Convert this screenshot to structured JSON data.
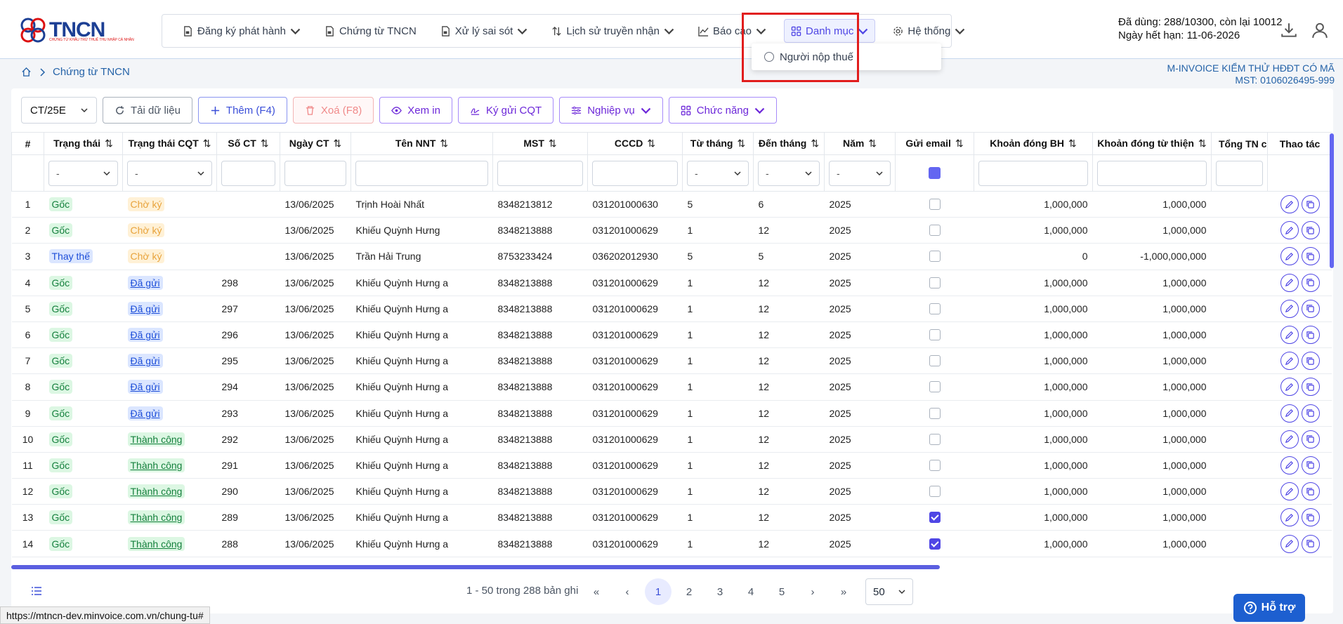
{
  "app": {
    "logo_text": "TNCN",
    "logo_subtitle": "CHỨNG TỪ KHẤU TRỪ THUẾ THU NHẬP CÁ NHÂN"
  },
  "nav": [
    {
      "label": "Đăng ký phát hành",
      "icon": "doc-icon",
      "has_menu": true
    },
    {
      "label": "Chứng từ TNCN",
      "icon": "doc-icon",
      "has_menu": false
    },
    {
      "label": "Xử lý sai sót",
      "icon": "doc-icon",
      "has_menu": true
    },
    {
      "label": "Lịch sử truyền nhận",
      "icon": "sort-icon",
      "has_menu": true
    },
    {
      "label": "Báo cáo",
      "icon": "chart-icon",
      "has_menu": true
    },
    {
      "label": "Danh mục",
      "icon": "grid-icon",
      "has_menu": true
    },
    {
      "label": "Hệ thống",
      "icon": "gear-icon",
      "has_menu": true
    }
  ],
  "dropdown": {
    "item": "Người nộp thuế"
  },
  "usage": {
    "line1": "Đã dùng: 288/10300, còn lại 10012",
    "line2": "Ngày hết hạn: 11-06-2026"
  },
  "breadcrumb": {
    "current": "Chứng từ TNCN"
  },
  "company": {
    "name": "M-INVOICE KIỂM THỬ HĐĐT CÓ MÃ",
    "tax_code": "MST: 0106026495-999"
  },
  "toolbar": {
    "template": "CT/25E",
    "reload": "Tải dữ liệu",
    "add": "Thêm (F4)",
    "delete": "Xoá (F8)",
    "print": "Xem in",
    "sign": "Ký gửi CQT",
    "business": "Nghiệp vụ",
    "functions": "Chức năng"
  },
  "table": {
    "headers": [
      "#",
      "Trạng thái",
      "Trạng thái CQT",
      "Số CT",
      "Ngày CT",
      "Tên NNT",
      "MST",
      "CCCD",
      "Từ tháng",
      "Đến tháng",
      "Năm",
      "Gửi email",
      "Khoản đóng BH",
      "Khoản đóng từ thiện",
      "Tổng TN c",
      "Thao tác"
    ],
    "filter_placeholder": "-",
    "rows": [
      {
        "no": "1",
        "status": "Gốc",
        "cqt": "Chờ ký",
        "so": "",
        "ngay": "13/06/2025",
        "ten": "Trịnh Hoài Nhất",
        "mst": "8348213812",
        "cccd": "031201000630",
        "tu": "5",
        "den": "6",
        "nam": "2025",
        "email": false,
        "bh": "1,000,000",
        "tt": "1,000,000"
      },
      {
        "no": "2",
        "status": "Gốc",
        "cqt": "Chờ ký",
        "so": "",
        "ngay": "13/06/2025",
        "ten": "Khiếu Quỳnh Hưng",
        "mst": "8348213888",
        "cccd": "031201000629",
        "tu": "1",
        "den": "12",
        "nam": "2025",
        "email": false,
        "bh": "1,000,000",
        "tt": "1,000,000"
      },
      {
        "no": "3",
        "status": "Thay thế",
        "cqt": "Chờ ký",
        "so": "",
        "ngay": "13/06/2025",
        "ten": "Trần Hải Trung",
        "mst": "8753233424",
        "cccd": "036202012930",
        "tu": "5",
        "den": "5",
        "nam": "2025",
        "email": false,
        "bh": "0",
        "tt": "-1,000,000,000"
      },
      {
        "no": "4",
        "status": "Gốc",
        "cqt": "Đã gửi",
        "so": "298",
        "ngay": "13/06/2025",
        "ten": "Khiếu Quỳnh Hưng a",
        "mst": "8348213888",
        "cccd": "031201000629",
        "tu": "1",
        "den": "12",
        "nam": "2025",
        "email": false,
        "bh": "1,000,000",
        "tt": "1,000,000"
      },
      {
        "no": "5",
        "status": "Gốc",
        "cqt": "Đã gửi",
        "so": "297",
        "ngay": "13/06/2025",
        "ten": "Khiếu Quỳnh Hưng a",
        "mst": "8348213888",
        "cccd": "031201000629",
        "tu": "1",
        "den": "12",
        "nam": "2025",
        "email": false,
        "bh": "1,000,000",
        "tt": "1,000,000"
      },
      {
        "no": "6",
        "status": "Gốc",
        "cqt": "Đã gửi",
        "so": "296",
        "ngay": "13/06/2025",
        "ten": "Khiếu Quỳnh Hưng a",
        "mst": "8348213888",
        "cccd": "031201000629",
        "tu": "1",
        "den": "12",
        "nam": "2025",
        "email": false,
        "bh": "1,000,000",
        "tt": "1,000,000"
      },
      {
        "no": "7",
        "status": "Gốc",
        "cqt": "Đã gửi",
        "so": "295",
        "ngay": "13/06/2025",
        "ten": "Khiếu Quỳnh Hưng a",
        "mst": "8348213888",
        "cccd": "031201000629",
        "tu": "1",
        "den": "12",
        "nam": "2025",
        "email": false,
        "bh": "1,000,000",
        "tt": "1,000,000"
      },
      {
        "no": "8",
        "status": "Gốc",
        "cqt": "Đã gửi",
        "so": "294",
        "ngay": "13/06/2025",
        "ten": "Khiếu Quỳnh Hưng a",
        "mst": "8348213888",
        "cccd": "031201000629",
        "tu": "1",
        "den": "12",
        "nam": "2025",
        "email": false,
        "bh": "1,000,000",
        "tt": "1,000,000"
      },
      {
        "no": "9",
        "status": "Gốc",
        "cqt": "Đã gửi",
        "so": "293",
        "ngay": "13/06/2025",
        "ten": "Khiếu Quỳnh Hưng a",
        "mst": "8348213888",
        "cccd": "031201000629",
        "tu": "1",
        "den": "12",
        "nam": "2025",
        "email": false,
        "bh": "1,000,000",
        "tt": "1,000,000"
      },
      {
        "no": "10",
        "status": "Gốc",
        "cqt": "Thành công",
        "so": "292",
        "ngay": "13/06/2025",
        "ten": "Khiếu Quỳnh Hưng a",
        "mst": "8348213888",
        "cccd": "031201000629",
        "tu": "1",
        "den": "12",
        "nam": "2025",
        "email": false,
        "bh": "1,000,000",
        "tt": "1,000,000"
      },
      {
        "no": "11",
        "status": "Gốc",
        "cqt": "Thành công",
        "so": "291",
        "ngay": "13/06/2025",
        "ten": "Khiếu Quỳnh Hưng a",
        "mst": "8348213888",
        "cccd": "031201000629",
        "tu": "1",
        "den": "12",
        "nam": "2025",
        "email": false,
        "bh": "1,000,000",
        "tt": "1,000,000"
      },
      {
        "no": "12",
        "status": "Gốc",
        "cqt": "Thành công",
        "so": "290",
        "ngay": "13/06/2025",
        "ten": "Khiếu Quỳnh Hưng a",
        "mst": "8348213888",
        "cccd": "031201000629",
        "tu": "1",
        "den": "12",
        "nam": "2025",
        "email": false,
        "bh": "1,000,000",
        "tt": "1,000,000"
      },
      {
        "no": "13",
        "status": "Gốc",
        "cqt": "Thành công",
        "so": "289",
        "ngay": "13/06/2025",
        "ten": "Khiếu Quỳnh Hưng a",
        "mst": "8348213888",
        "cccd": "031201000629",
        "tu": "1",
        "den": "12",
        "nam": "2025",
        "email": true,
        "bh": "1,000,000",
        "tt": "1,000,000"
      },
      {
        "no": "14",
        "status": "Gốc",
        "cqt": "Thành công",
        "so": "288",
        "ngay": "13/06/2025",
        "ten": "Khiếu Quỳnh Hưng a",
        "mst": "8348213888",
        "cccd": "031201000629",
        "tu": "1",
        "den": "12",
        "nam": "2025",
        "email": true,
        "bh": "1,000,000",
        "tt": "1,000,000"
      }
    ]
  },
  "pagination": {
    "info": "1 - 50 trong 288 bản ghi",
    "pages": [
      "1",
      "2",
      "3",
      "4",
      "5"
    ],
    "current": "1",
    "page_size": "50"
  },
  "support": {
    "label": "Hỗ trợ"
  },
  "status_url": "https://mtncn-dev.minvoice.com.vn/chung-tu#",
  "colors": {
    "accent": "#4f46e5",
    "link": "#2563a8",
    "highlight": "#e11d1d"
  }
}
